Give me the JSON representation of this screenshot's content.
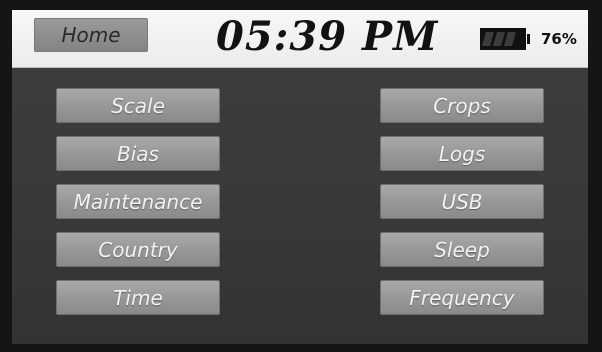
{
  "header": {
    "home_label": "Home",
    "time": "05:39 PM",
    "battery": {
      "level": 0.76,
      "percent_label": "76%"
    }
  },
  "menu": {
    "left": [
      "Scale",
      "Bias",
      "Maintenance",
      "Country",
      "Time"
    ],
    "right": [
      "Crops",
      "Logs",
      "USB",
      "Sleep",
      "Frequency"
    ]
  },
  "colors": {
    "header_bg": "#f2f2f2",
    "screen_bg": "#3a3a3a",
    "button_bg": "#9c9c9c",
    "button_text": "#f2f2f2"
  }
}
